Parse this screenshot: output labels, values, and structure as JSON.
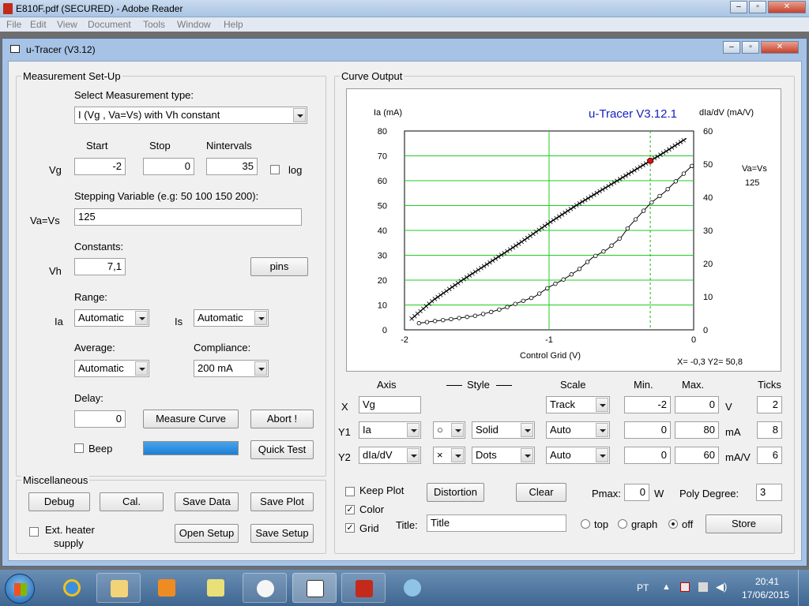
{
  "reader": {
    "title": "E810F.pdf (SECURED) - Adobe Reader",
    "menu": [
      "File",
      "Edit",
      "View",
      "Document",
      "Tools",
      "Window",
      "Help"
    ]
  },
  "window": {
    "title": "u-Tracer (V3.12)"
  },
  "setup": {
    "group_label": "Measurement Set-Up",
    "select_type_label": "Select Measurement type:",
    "measurement_type": "I (Vg , Va=Vs) with Vh constant",
    "start_label": "Start",
    "stop_label": "Stop",
    "nintervals_label": "Nintervals",
    "vg_label": "Vg",
    "vg_start": "-2",
    "vg_stop": "0",
    "vg_nintervals": "35",
    "log_label": "log",
    "stepping_label": "Stepping Variable (e.g: 50 100 150 200):",
    "vavs_label": "Va=Vs",
    "stepping_value": "125",
    "constants_label": "Constants:",
    "vh_label": "Vh",
    "vh_value": "7,1",
    "pins_label": "pins",
    "range_label": "Range:",
    "ia_label": "Ia",
    "ia_range": "Automatic",
    "is_label": "Is",
    "is_range": "Automatic",
    "average_label": "Average:",
    "average_value": "Automatic",
    "compliance_label": "Compliance:",
    "compliance_value": "200 mA",
    "delay_label": "Delay:",
    "delay_value": "0",
    "measure_label": "Measure Curve",
    "abort_label": "Abort !",
    "beep_label": "Beep",
    "progress": 1.0,
    "quicktest_label": "Quick Test"
  },
  "misc": {
    "group_label": "Miscellaneous",
    "debug_label": "Debug",
    "cal_label": "Cal.",
    "savedata_label": "Save Data",
    "saveplot_label": "Save Plot",
    "extheater_label_1": "Ext. heater",
    "extheater_label_2": "supply",
    "opensetup_label": "Open Setup",
    "savesetup_label": "Save Setup"
  },
  "curve": {
    "group_label": "Curve Output",
    "plot_title": "u-Tracer V3.12.1",
    "left_axis_label": "Ia (mA)",
    "right_axis_label": "dIa/dV (mA/V)",
    "x_axis_label": "Control Grid (V)",
    "legend_line1": "Va=Vs",
    "legend_line2": "125",
    "readout": "X= -0,3   Y2= 50,8",
    "left_ticks": [
      "80",
      "70",
      "60",
      "50",
      "40",
      "30",
      "20",
      "10",
      "0"
    ],
    "right_ticks": [
      "60",
      "50",
      "40",
      "30",
      "20",
      "10",
      "0"
    ],
    "x_ticks": [
      "-2",
      "-1",
      "0"
    ]
  },
  "chart_data": {
    "type": "line",
    "title": "u-Tracer V3.12.1",
    "xlabel": "Control Grid (V)",
    "ylabel": "Ia (mA)",
    "y2label": "dIa/dV (mA/V)",
    "xlim": [
      -2,
      0
    ],
    "ylim": [
      0,
      80
    ],
    "y2lim": [
      0,
      60
    ],
    "grid": true,
    "cursor_x": -0.3,
    "series": [
      {
        "name": "Ia",
        "axis": "y1",
        "marker": "x",
        "style": "Solid",
        "color": "#000000",
        "x": [
          -1.95,
          -1.8,
          -1.6,
          -1.4,
          -1.2,
          -1.0,
          -0.8,
          -0.6,
          -0.4,
          -0.3,
          -0.2,
          -0.05
        ],
        "y": [
          4.5,
          12,
          20,
          27.5,
          35,
          43,
          50.5,
          57.5,
          64.5,
          68,
          71.5,
          77
        ]
      },
      {
        "name": "dIa/dV",
        "axis": "y2",
        "marker": "o",
        "style": "Dots",
        "color": "#000000",
        "x": [
          -1.9,
          -1.8,
          -1.7,
          -1.6,
          -1.5,
          -1.4,
          -1.3,
          -1.2,
          -1.1,
          -1.0,
          -0.9,
          -0.8,
          -0.7,
          -0.6,
          -0.5,
          -0.45,
          -0.4,
          -0.3,
          -0.2,
          -0.1,
          0.0
        ],
        "y": [
          2,
          2.6,
          3.1,
          3.7,
          4.3,
          5.4,
          6.7,
          8.4,
          10.0,
          12.9,
          15.2,
          18.0,
          21.8,
          24.2,
          28.0,
          31.0,
          33.4,
          38.1,
          41.6,
          45.8,
          50.0
        ]
      }
    ]
  },
  "controls": {
    "axis_header": "Axis",
    "style_header": "Style",
    "scale_header": "Scale",
    "min_header": "Min.",
    "max_header": "Max.",
    "ticks_header": "Ticks",
    "x_label": "X",
    "x_axis": "Vg",
    "x_scale": "Track",
    "x_min": "-2",
    "x_max": "0",
    "x_unit": "V",
    "x_ticks": "2",
    "y1_label": "Y1",
    "y1_axis": "Ia",
    "y1_marker": "○",
    "y1_style": "Solid",
    "y1_scale": "Auto",
    "y1_min": "0",
    "y1_max": "80",
    "y1_unit": "mA",
    "y1_ticks": "8",
    "y2_label": "Y2",
    "y2_axis": "dIa/dV",
    "y2_marker": "×",
    "y2_style": "Dots",
    "y2_scale": "Auto",
    "y2_min": "0",
    "y2_max": "60",
    "y2_unit": "mA/V",
    "y2_ticks": "6",
    "keepplot_label": "Keep Plot",
    "distortion_label": "Distortion",
    "clear_label": "Clear",
    "pmax_label": "Pmax:",
    "pmax_value": "0",
    "pmax_unit": "W",
    "polydeg_label": "Poly Degree:",
    "polydeg_value": "3",
    "color_label": "Color",
    "grid_label": "Grid",
    "title_label": "Title:",
    "title_value": "Title",
    "top_label": "top",
    "graph_label": "graph",
    "off_label": "off",
    "store_label": "Store"
  },
  "taskbar": {
    "language": "PT",
    "time": "20:41",
    "date": "17/06/2015"
  }
}
